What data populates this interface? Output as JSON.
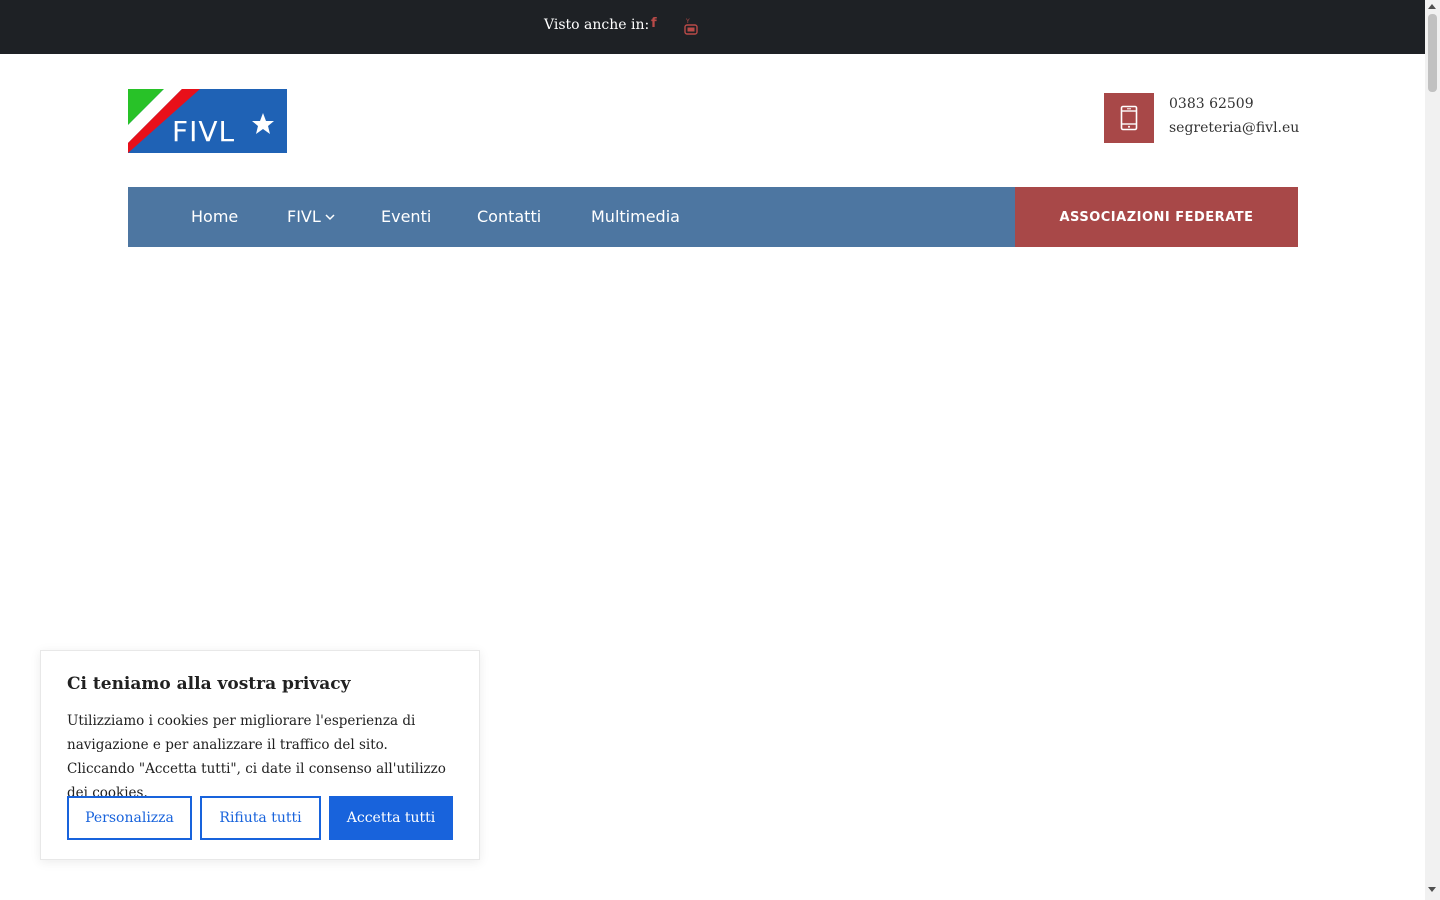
{
  "topbar": {
    "seen_label": "Visto anche in:",
    "facebook_glyph": "f",
    "social_icons": [
      "facebook-icon",
      "youtube-icon"
    ],
    "social_color": "#b94a48"
  },
  "logo": {
    "text": "FIVL"
  },
  "contact": {
    "icon": "mobile-phone-icon",
    "phone": "0383 62509",
    "email": "segreteria@fivl.eu"
  },
  "nav": {
    "items": [
      {
        "label": "Home"
      },
      {
        "label": "FIVL",
        "has_dropdown": true
      },
      {
        "label": "Eventi"
      },
      {
        "label": "Contatti"
      },
      {
        "label": "Multimedia"
      }
    ],
    "cta_label": "ASSOCIAZIONI FEDERATE",
    "bar_color": "#4d76a1",
    "cta_color": "#a84848"
  },
  "cookie_banner": {
    "title": "Ci teniamo alla vostra privacy",
    "text": "Utilizziamo i cookies per migliorare l'esperienza di navigazione e per analizzare il traffico del sito. Cliccando \"Accetta tutti\", ci date il consenso all'utilizzo dei cookies.",
    "buttons": {
      "customize": "Personalizza",
      "reject": "Rifiuta tutti",
      "accept": "Accetta tutti"
    },
    "accent_color": "#1863dc"
  }
}
